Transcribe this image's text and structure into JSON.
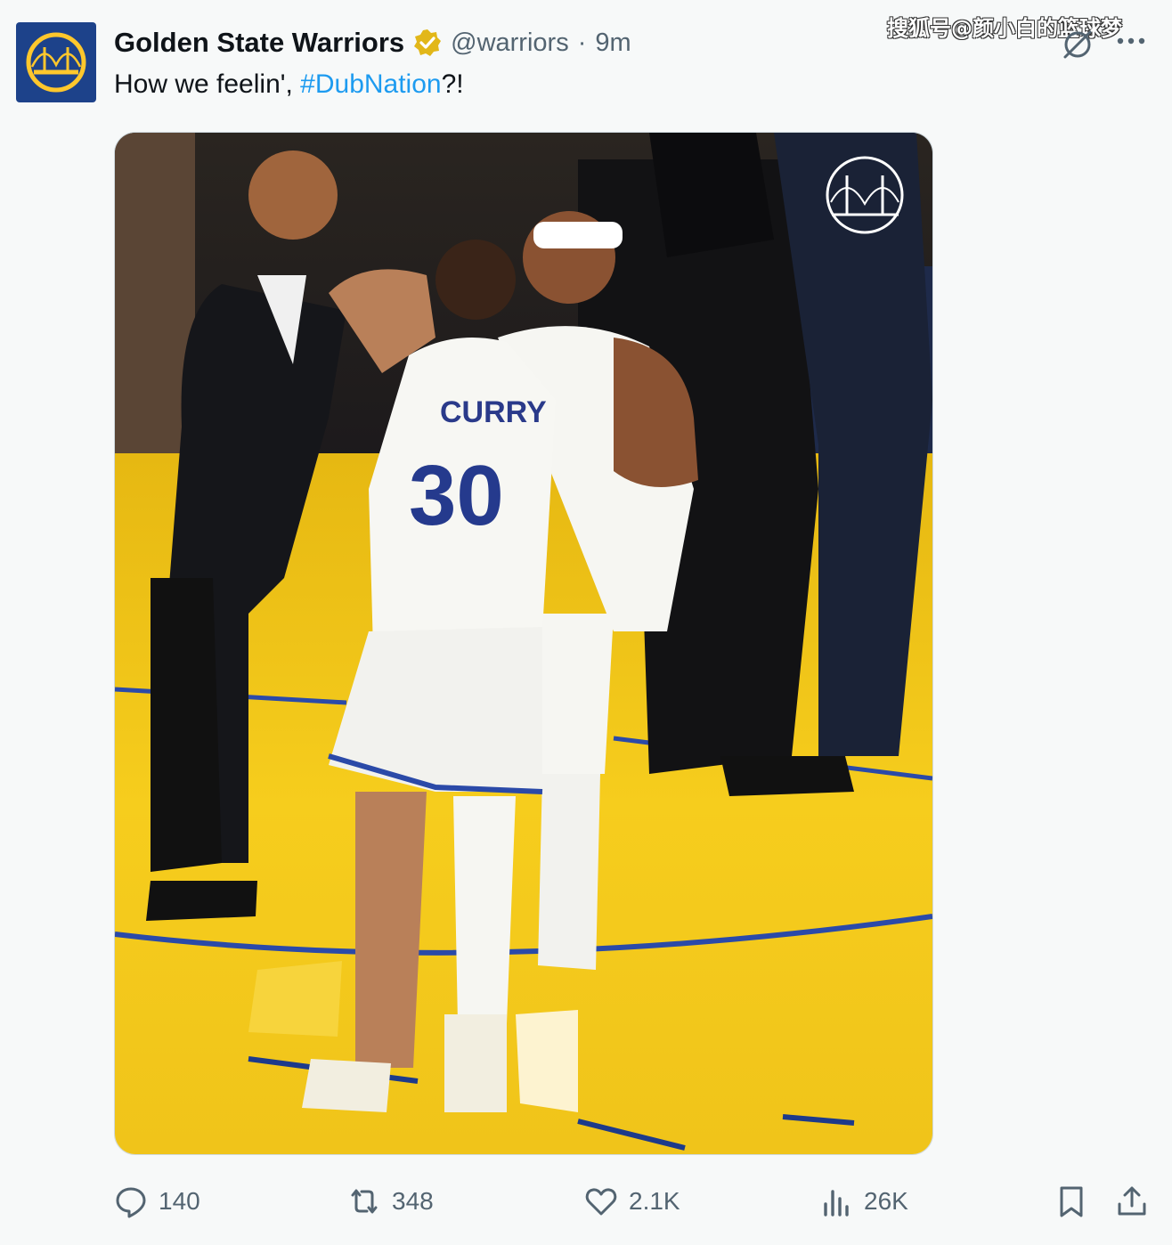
{
  "tweet": {
    "author_name": "Golden State Warriors",
    "handle": "@warriors",
    "separator": "·",
    "time": "9m",
    "text_before": "How we feelin', ",
    "hashtag": "#DubNation",
    "text_after": "?!"
  },
  "watermark": "搜狐号@颜小白的篮球梦",
  "media": {
    "jersey_name": "CURRY",
    "jersey_number": "30"
  },
  "actions": {
    "replies": "140",
    "reposts": "348",
    "likes": "2.1K",
    "views": "26K"
  },
  "icons": {
    "avatar": "warriors-logo-icon",
    "verified": "verified-badge-icon",
    "grok": "grok-icon",
    "more": "more-icon",
    "reply": "reply-icon",
    "repost": "repost-icon",
    "like": "heart-icon",
    "views": "views-icon",
    "bookmark": "bookmark-icon",
    "share": "share-icon"
  },
  "colors": {
    "warriors_blue": "#1d428a",
    "warriors_gold": "#ffc72c",
    "link": "#1d9bf0",
    "verified_gold": "#e2b719"
  }
}
